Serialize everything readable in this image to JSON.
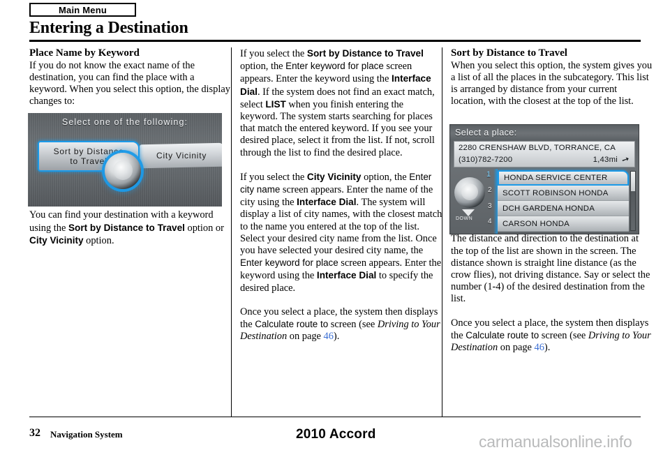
{
  "header": {
    "tab_label": "Main Menu",
    "chapter_title": "Entering a Destination"
  },
  "columns": {
    "left": {
      "section_heading": "Place Name by Keyword",
      "paragraph_1": "If you do not know the exact name of the destination, you can find the place with a keyword. When you select this option, the display changes to:",
      "paragraph_2_part1": "You can find your destination with a keyword using the ",
      "paragraph_2_bold1": "Sort by Distance to Travel",
      "paragraph_2_part2": " option or ",
      "paragraph_2_bold2": "City Vicinity",
      "paragraph_2_part3": " option."
    },
    "middle": {
      "p1_a": "If you select the ",
      "p1_b_sort": "Sort by Distance to Travel",
      "p1_c": " option, the ",
      "p1_ui_enter_keyword": "Enter keyword for place",
      "p1_d": " screen appears. Enter the keyword using the ",
      "p1_b_dial": "Interface Dial",
      "p1_e": ". If the system does not find an exact match, select ",
      "p1_b_list": "LIST",
      "p1_f": " when you finish entering the keyword. The system starts searching for places that match the entered keyword. If you see your desired place, select it from the list. If not, scroll through the list to find the desired place.",
      "p2_a": "If you select the ",
      "p2_b_city": "City Vicinity",
      "p2_c": " option, the ",
      "p2_ui_enter_city": "Enter city name",
      "p2_d": " screen appears. Enter the name of the city using the ",
      "p2_b_dial": "Interface Dial",
      "p2_e": ". The system will display a list of city names, with the closest match to the name you entered at the top of the list. Select your desired city name from the list. Once you have selected your desired city name, the ",
      "p2_ui_enter_keyword": "Enter keyword for place",
      "p2_f": " screen appears. Enter the keyword using the ",
      "p2_b_dial2": "Interface Dial",
      "p2_g": " to specify the desired place.",
      "p3_a": "Once you select a place, the system then displays the ",
      "p3_ui_calc": "Calculate route to",
      "p3_b": " screen (see ",
      "p3_italic": "Driving to Your Destination",
      "p3_c": " on page ",
      "p3_page": "46",
      "p3_d": ")."
    },
    "right": {
      "section_heading": "Sort by Distance to Travel",
      "paragraph_1": "When you select this option, the system gives you a list of all the places in the subcategory. This list is arranged by distance from your current location, with the closest at the top of the list.",
      "paragraph_2": "The distance and direction to the destination at the top of the list are shown in the screen. The distance shown is straight line distance (as the crow flies), not driving distance. Say or select the number (1-4) of the desired destination from the list.",
      "p3_a": "Once you select a place, the system then displays the ",
      "p3_ui_calc": "Calculate route to",
      "p3_b": " screen (see ",
      "p3_italic": "Driving to Your Destination",
      "p3_c": " on page ",
      "p3_page": "46",
      "p3_d": ")."
    }
  },
  "navshot_left": {
    "title": "Select one of the following:",
    "button_sort_line1": "Sort by Distance",
    "button_sort_line2": "to Travel",
    "button_city": "City Vicinity",
    "dial_icon": "interface-dial",
    "highlight_color": "#1b9ae8"
  },
  "navshot_right": {
    "title": "Select a place:",
    "address": "2280 CRENSHAW BLVD, TORRANCE, CA",
    "phone": "(310)782-7200",
    "distance": "1,43mi",
    "direction_icon": "direction-arrow",
    "dial_icon": "interface-dial",
    "down_label": "DOWN",
    "list": [
      {
        "number": "1",
        "name": "HONDA SERVICE CENTER",
        "selected": true
      },
      {
        "number": "2",
        "name": "SCOTT ROBINSON HONDA",
        "selected": false
      },
      {
        "number": "3",
        "name": "DCH GARDENA HONDA",
        "selected": false
      },
      {
        "number": "4",
        "name": "CARSON HONDA",
        "selected": false
      }
    ],
    "highlight_color": "#1b9ae8"
  },
  "footer": {
    "page_number": "32",
    "section_name": "Navigation System",
    "model_year": "2010 Accord",
    "watermark": "carmanualsonline.info"
  }
}
